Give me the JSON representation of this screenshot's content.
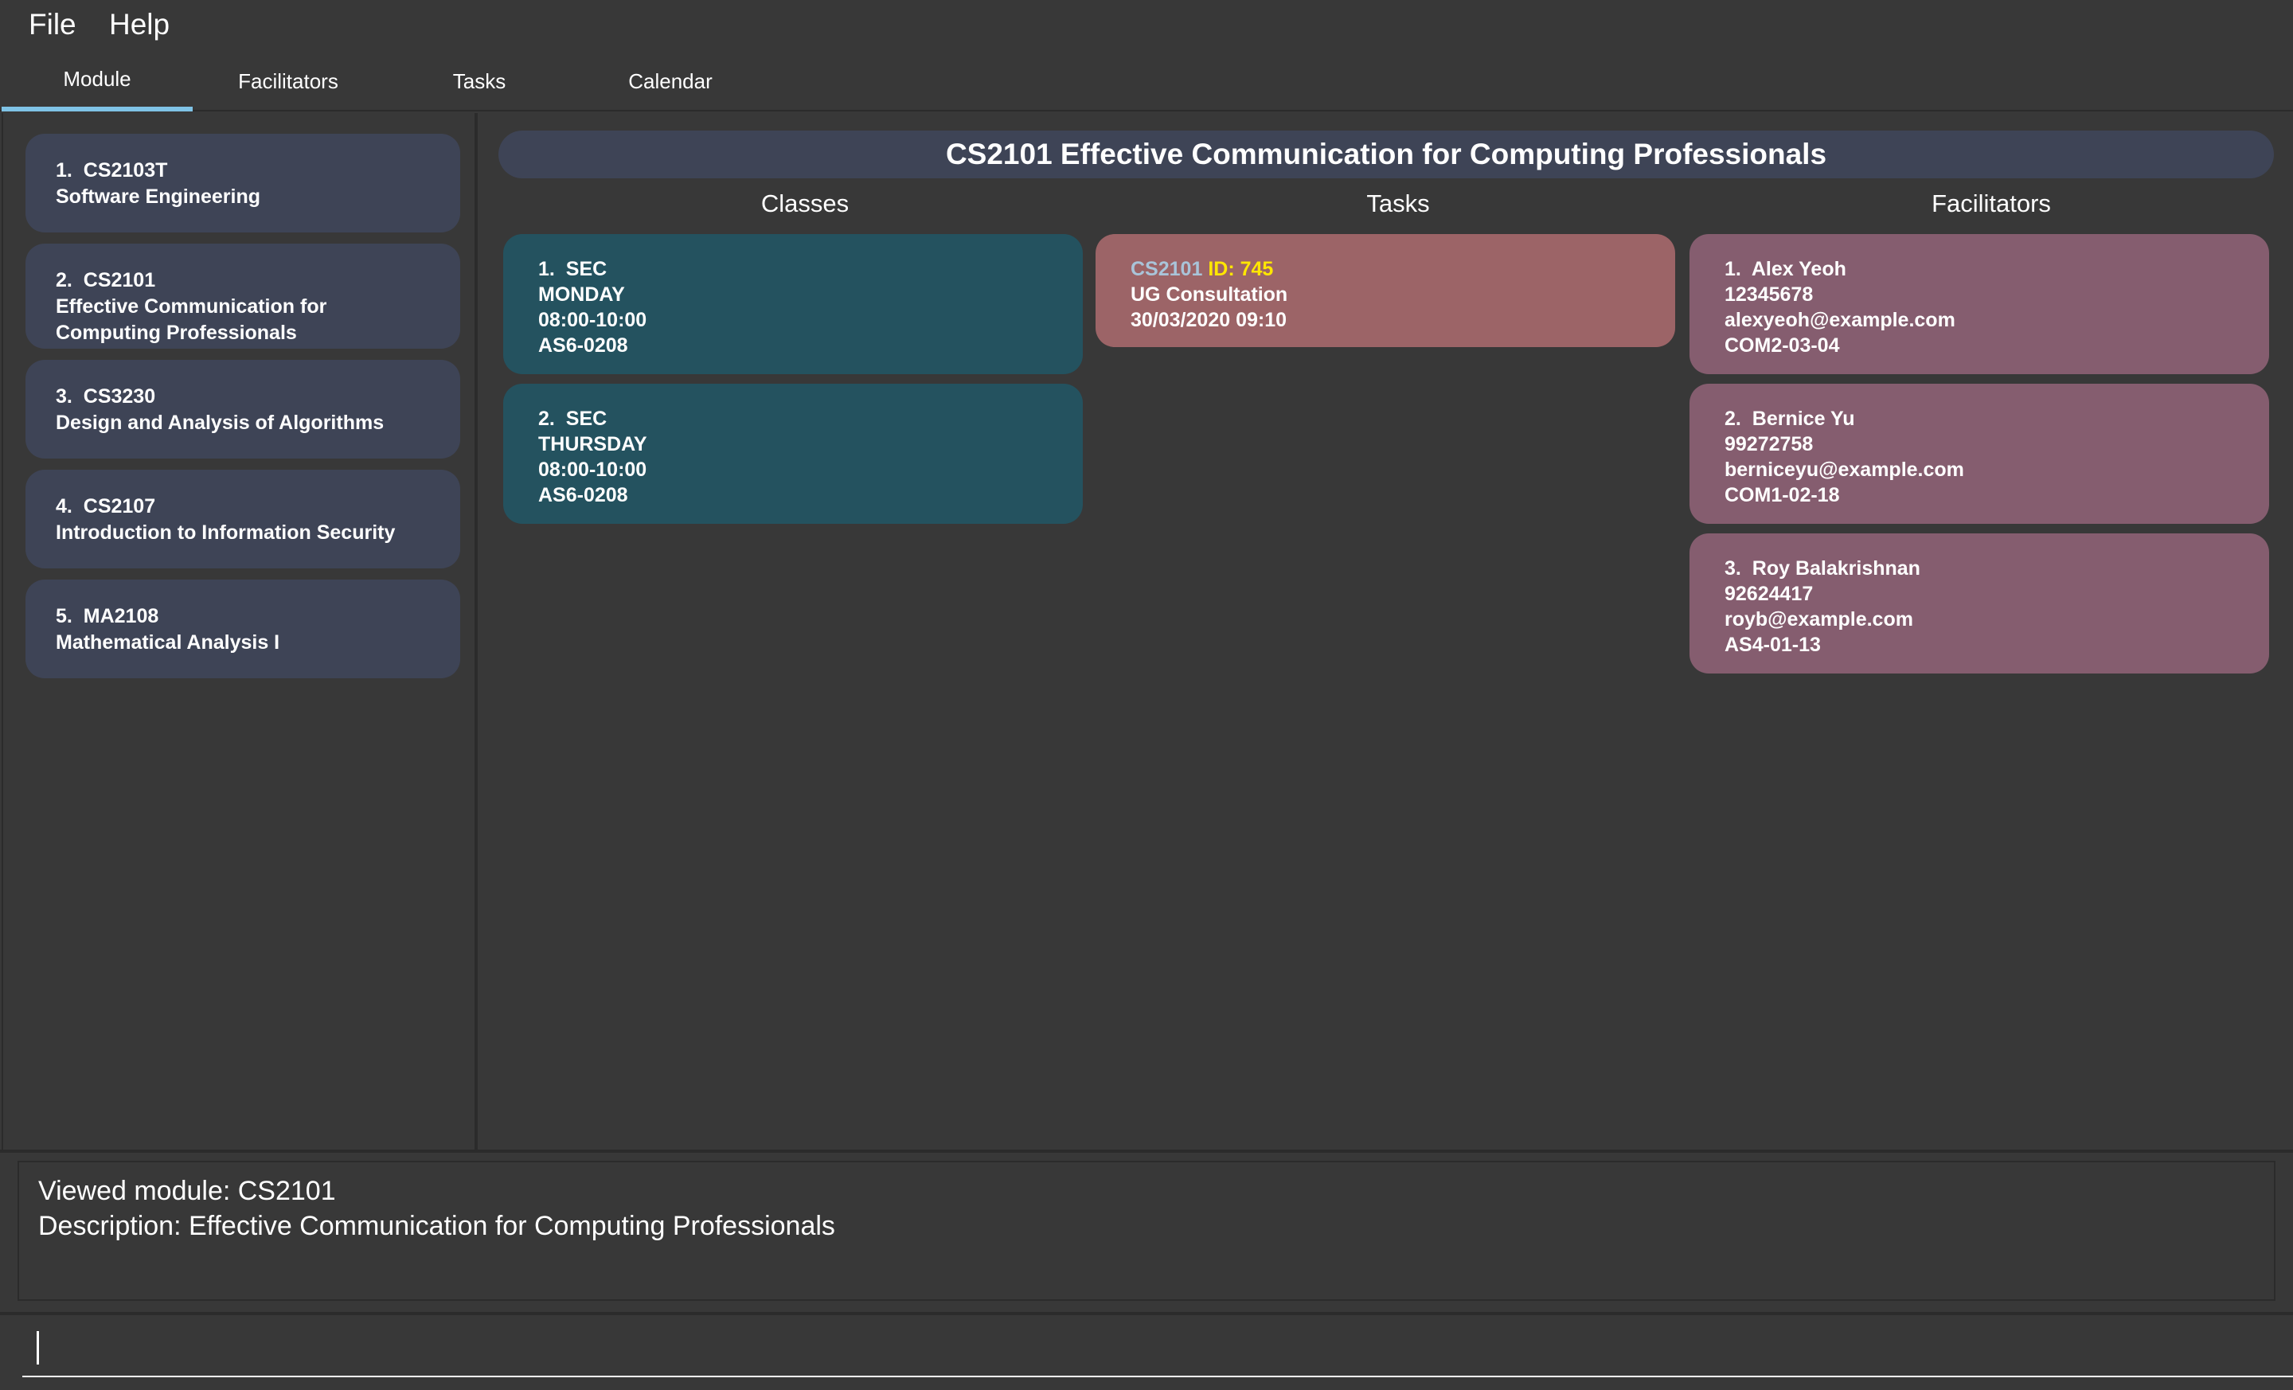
{
  "menu": {
    "file": "File",
    "help": "Help"
  },
  "tabs": [
    "Module",
    "Facilitators",
    "Tasks",
    "Calendar"
  ],
  "modules": [
    {
      "index": "1.",
      "code": "CS2103T",
      "name": "Software Engineering"
    },
    {
      "index": "2.",
      "code": "CS2101",
      "name_line1": "Effective Communication for",
      "name_line2": "Computing Professionals"
    },
    {
      "index": "3.",
      "code": "CS3230",
      "name": "Design and Analysis of Algorithms"
    },
    {
      "index": "4.",
      "code": "CS2107",
      "name": "Introduction to Information Security"
    },
    {
      "index": "5.",
      "code": "MA2108",
      "name": "Mathematical Analysis I"
    }
  ],
  "detail": {
    "title": "CS2101 Effective Communication for Computing Professionals",
    "headers": {
      "classes": "Classes",
      "tasks": "Tasks",
      "facilitators": "Facilitators"
    },
    "classes": [
      {
        "index": "1.",
        "type": "SEC",
        "day": "MONDAY",
        "time": "08:00-10:00",
        "venue": "AS6-0208"
      },
      {
        "index": "2.",
        "type": "SEC",
        "day": "THURSDAY",
        "time": "08:00-10:00",
        "venue": "AS6-0208"
      }
    ],
    "tasks": [
      {
        "module": "CS2101",
        "id": "ID: 745",
        "description": "UG Consultation",
        "datetime": "30/03/2020 09:10"
      }
    ],
    "facilitators": [
      {
        "index": "1.",
        "name": "Alex Yeoh",
        "phone": "12345678",
        "email": "alexyeoh@example.com",
        "office": "COM2-03-04"
      },
      {
        "index": "2.",
        "name": "Bernice Yu",
        "phone": "99272758",
        "email": "berniceyu@example.com",
        "office": "COM1-02-18"
      },
      {
        "index": "3.",
        "name": "Roy Balakrishnan",
        "phone": "92624417",
        "email": "royb@example.com",
        "office": "AS4-01-13"
      }
    ]
  },
  "result": {
    "line1": "Viewed module: CS2101",
    "line2": "Description: Effective Communication for Computing Professionals"
  },
  "command": {
    "value": ""
  },
  "colors": {
    "background": "#383838",
    "card_module": "#3e4456",
    "card_class": "#24525f",
    "card_task": "#9c6467",
    "card_facilitator": "#855d6f",
    "tab_active": "#7fc3e6",
    "task_id": "#ffe600"
  }
}
